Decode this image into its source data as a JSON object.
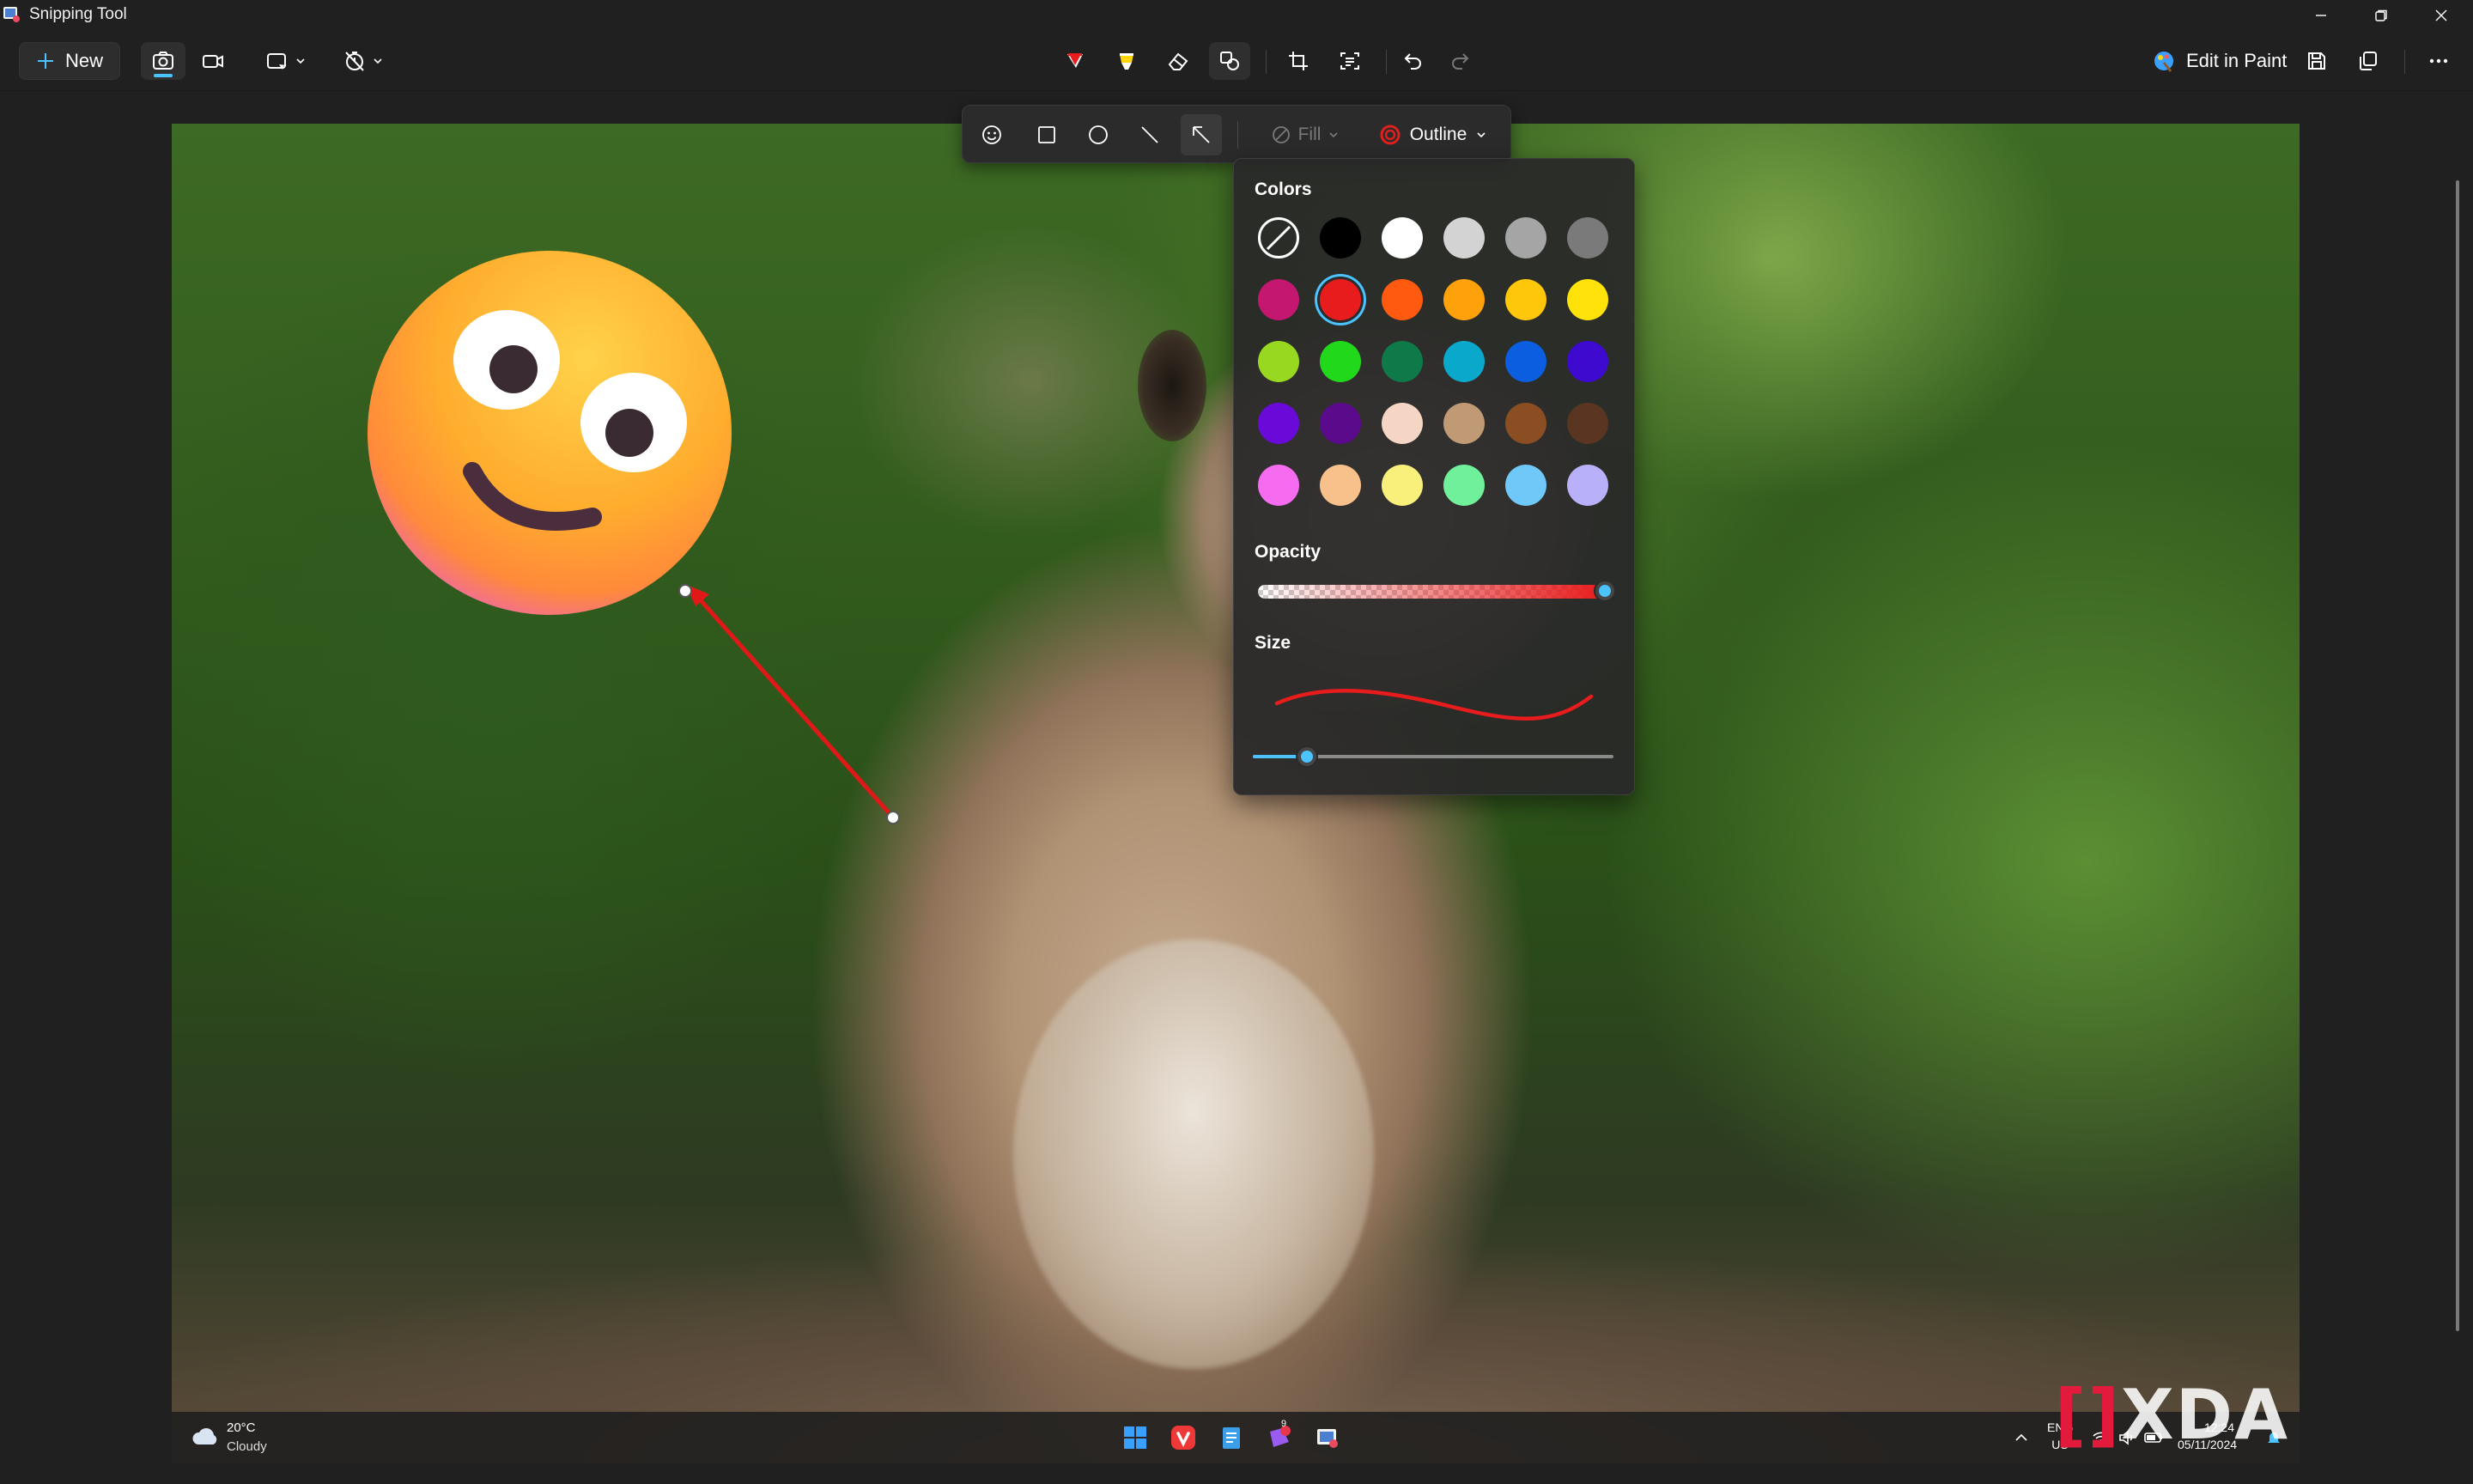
{
  "window": {
    "title": "Snipping Tool",
    "controls": [
      "minimize",
      "restore",
      "close"
    ]
  },
  "toolbar": {
    "new_label": "New",
    "capture_modes": [
      "screenshot-icon",
      "video-icon"
    ],
    "active_mode": "screenshot-icon",
    "snip_shape_icon": "rectangle-snip-icon",
    "delay_icon": "timer-off-icon",
    "tools": [
      "ballpoint-pen-icon",
      "highlighter-icon",
      "eraser-icon",
      "shapes-icon",
      "crop-icon",
      "text-actions-icon",
      "undo-icon",
      "redo-icon"
    ],
    "active_tool": "shapes-icon",
    "edit_in_paint_label": "Edit in Paint",
    "right_icons": [
      "save-icon",
      "copy-icon",
      "more-icon"
    ]
  },
  "shape_toolbar": {
    "shapes": [
      "emoji-icon",
      "rectangle-icon",
      "ellipse-icon",
      "line-icon",
      "arrow-icon"
    ],
    "active_shape": "arrow-icon",
    "fill_label": "Fill",
    "outline_label": "Outline",
    "outline_color": "#e02020"
  },
  "popup": {
    "colors_heading": "Colors",
    "colors": [
      [
        "none",
        "#000000",
        "#ffffff",
        "#d3d3d3",
        "#a5a5a5",
        "#7a7a7a"
      ],
      [
        "#c4176f",
        "#e81c1c",
        "#ff5a10",
        "#ffa10a",
        "#ffc70a",
        "#ffe20a"
      ],
      [
        "#98d820",
        "#22d81a",
        "#0e7a4a",
        "#0aa9cc",
        "#0b5ee0",
        "#3e0ad0"
      ],
      [
        "#6a0ad8",
        "#5a0a8a",
        "#f5d6c4",
        "#c09a74",
        "#8a4e22",
        "#5a3522"
      ],
      [
        "#f56cf0",
        "#f8c08a",
        "#f8f07a",
        "#70f09a",
        "#70c8f8",
        "#b8b0f8"
      ]
    ],
    "selected_color": "#e81c1c",
    "opacity_heading": "Opacity",
    "opacity_value": 1.0,
    "size_heading": "Size",
    "size_value": 0.15
  },
  "taskbar": {
    "weather_temp": "20°C",
    "weather_condition": "Cloudy",
    "apps": [
      "windows-start-icon",
      "vivaldi-icon",
      "notepad-icon",
      "teams-icon",
      "snipping-tool-icon"
    ],
    "notification_count": "9",
    "language_top": "ENG",
    "language_bottom": "US",
    "time": "12:24",
    "date": "05/11/2024"
  },
  "watermark": "XDA"
}
